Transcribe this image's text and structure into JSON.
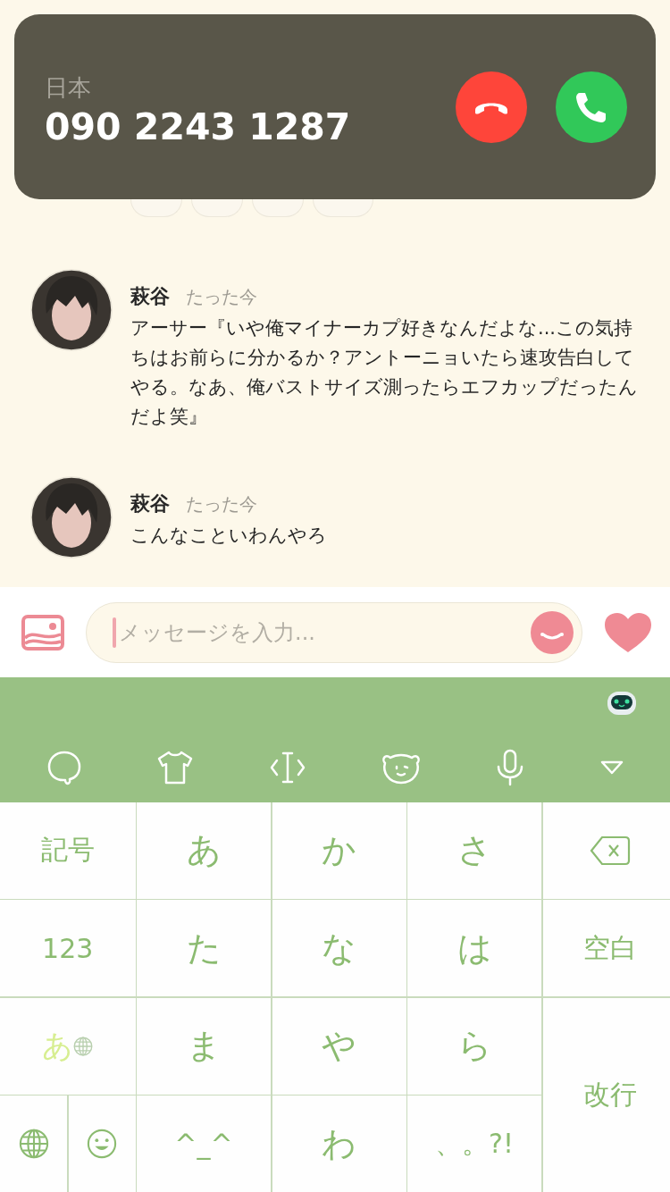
{
  "incoming_call": {
    "region": "日本",
    "number": "090 2243 1287"
  },
  "reactions": [
    {
      "kind": "chip"
    },
    {
      "kind": "chip"
    },
    {
      "kind": "chip"
    },
    {
      "kind": "chip"
    }
  ],
  "messages": [
    {
      "sender": "萩谷",
      "time": "たった今",
      "text": "アーサー『いや俺マイナーカプ好きなんだよな...この気持ちはお前らに分かるか？アントーニョいたら速攻告白してやる。なあ、俺バストサイズ測ったらエフカップだったんだよ笑』"
    },
    {
      "sender": "萩谷",
      "time": "たった今",
      "text": "こんなこといわんやろ"
    }
  ],
  "composer": {
    "placeholder": "メッセージを入力..."
  },
  "keyboard": {
    "keys": [
      {
        "kind": "char",
        "label": "記号"
      },
      {
        "kind": "char",
        "label": "あ"
      },
      {
        "kind": "char",
        "label": "か"
      },
      {
        "kind": "char",
        "label": "さ"
      },
      {
        "kind": "backspace"
      },
      {
        "kind": "char",
        "label": "123"
      },
      {
        "kind": "char",
        "label": "た"
      },
      {
        "kind": "char",
        "label": "な"
      },
      {
        "kind": "char",
        "label": "は"
      },
      {
        "kind": "char",
        "label": "空白"
      },
      {
        "kind": "mode",
        "label": "あ"
      },
      {
        "kind": "char",
        "label": "ま"
      },
      {
        "kind": "char",
        "label": "や"
      },
      {
        "kind": "char",
        "label": "ら"
      },
      {
        "kind": "char",
        "label": "改行"
      },
      {
        "kind": "globe"
      },
      {
        "kind": "emoji"
      },
      {
        "kind": "char",
        "label": "^_^"
      },
      {
        "kind": "char",
        "label": "わ"
      },
      {
        "kind": "char",
        "label": "、。?!"
      }
    ]
  }
}
